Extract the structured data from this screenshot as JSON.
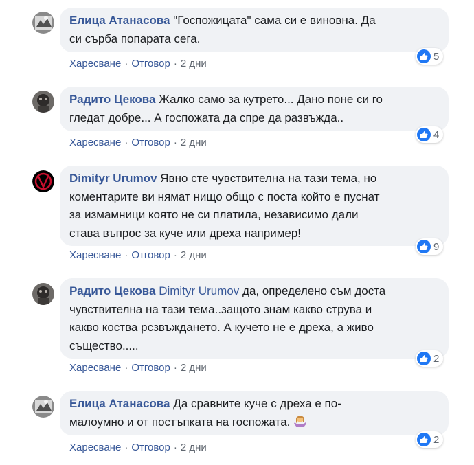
{
  "colors": {
    "accent": "#385898",
    "bubble": "#f0f2f5",
    "like": "#2078f4",
    "meta": "#606770"
  },
  "comments": [
    {
      "author": "Елица Атанасова",
      "mention": "",
      "lines": [
        "\"Госпожицата\" сама си е виновна. Да",
        "си сърба попарата сега."
      ],
      "reactions": "5",
      "like_label": "Харесване",
      "reply_label": "Отговор",
      "time": "2 дни",
      "reaction_icon": "like-icon"
    },
    {
      "author": "Радито Цекова",
      "mention": "",
      "lines": [
        "Жалко само за кутрето... Дано поне си го",
        "гледат добре... А госпожата да спре да развъжда.."
      ],
      "reactions": "4",
      "like_label": "Харесване",
      "reply_label": "Отговор",
      "time": "2 дни",
      "reaction_icon": "like-icon"
    },
    {
      "author": "Dimityr Urumov",
      "mention": "",
      "lines": [
        "Явно сте чувствителна на тази тема, но",
        "коментарите ви нямат нищо общо с поста който е пуснат",
        "за измамници която не си платила, независимо дали",
        "става въпрос за куче или дреха например!"
      ],
      "reactions": "9",
      "like_label": "Харесване",
      "reply_label": "Отговор",
      "time": "2 дни",
      "reaction_icon": "like-icon"
    },
    {
      "author": "Радито Цекова",
      "mention": "Dimityr Urumov",
      "lines": [
        "да, определено съм доста",
        "чувствителна на тази тема..защото знам какво струва и",
        "какво коства рсзвъждането. А кучето не е дреха, а живо",
        "същество....."
      ],
      "reactions": "2",
      "like_label": "Харесване",
      "reply_label": "Отговор",
      "time": "2 дни",
      "reaction_icon": "like-icon"
    },
    {
      "author": "Елица Атанасова",
      "mention": "",
      "lines": [
        "Да сравните куче с дреха е по-",
        "малоумно и от постъпката на госпожата."
      ],
      "reactions": "2",
      "like_label": "Харесване",
      "reply_label": "Отговор",
      "time": "2 дни",
      "reaction_icon": "like-icon",
      "emoji": "woman-shrugging-emoji"
    }
  ]
}
